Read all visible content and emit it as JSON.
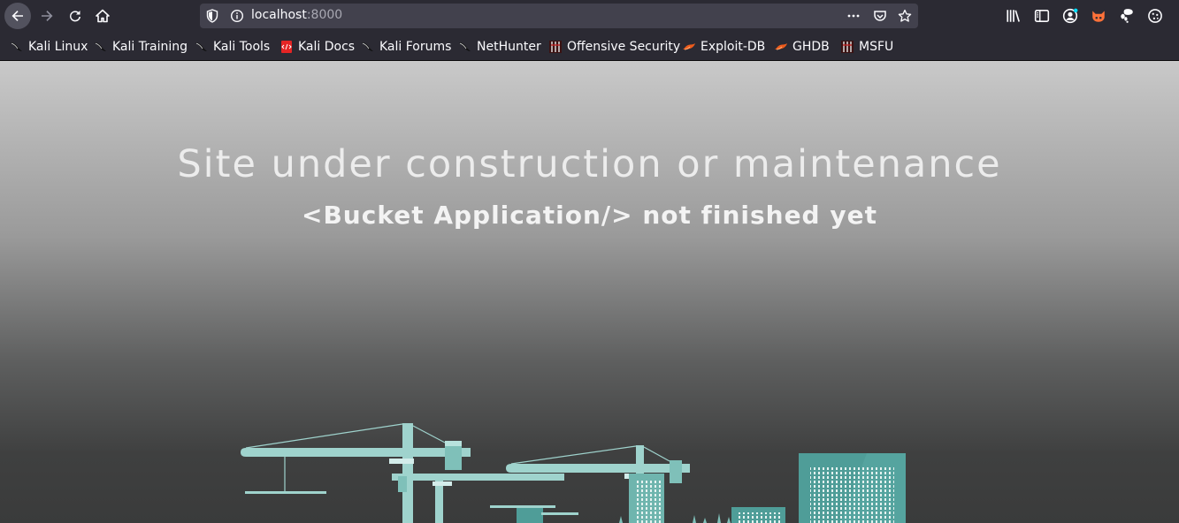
{
  "browser": {
    "url_host": "localhost",
    "url_port": ":8000",
    "icons": {
      "back": "arrow-left-icon",
      "forward": "arrow-right-icon",
      "reload": "reload-icon",
      "home": "home-icon",
      "site_info": "shield-icon",
      "page_info": "info-icon",
      "page_actions": "more-horizontal-icon",
      "pocket": "pocket-icon",
      "bookmark_star": "star-icon",
      "library": "library-icon",
      "sidebar": "sidebar-icon",
      "account": "account-icon",
      "extension_1": "extension-fox-icon",
      "extension_2": "extension-gnome-icon",
      "extension_3": "cookie-icon"
    }
  },
  "bookmarks": [
    {
      "label": "Kali Linux",
      "icon": "kali-dragon-icon"
    },
    {
      "label": "Kali Training",
      "icon": "kali-dragon-icon"
    },
    {
      "label": "Kali Tools",
      "icon": "kali-dragon-icon"
    },
    {
      "label": "Kali Docs",
      "icon": "kali-docs-icon"
    },
    {
      "label": "Kali Forums",
      "icon": "kali-dragon-icon"
    },
    {
      "label": "NetHunter",
      "icon": "kali-dragon-icon"
    },
    {
      "label": "Offensive Security",
      "icon": "offsec-icon"
    },
    {
      "label": "Exploit-DB",
      "icon": "exploit-db-icon"
    },
    {
      "label": "GHDB",
      "icon": "exploit-db-icon"
    },
    {
      "label": "MSFU",
      "icon": "offsec-icon"
    }
  ],
  "page": {
    "title": "Site under construction or maintenance",
    "subtitle": "<Bucket Application/> not finished yet"
  },
  "colors": {
    "chrome": "#2b2a33",
    "urlbar": "#42414d",
    "illustration_teal": "#9fd3cd",
    "illustration_dark_teal": "#4f9d98"
  }
}
